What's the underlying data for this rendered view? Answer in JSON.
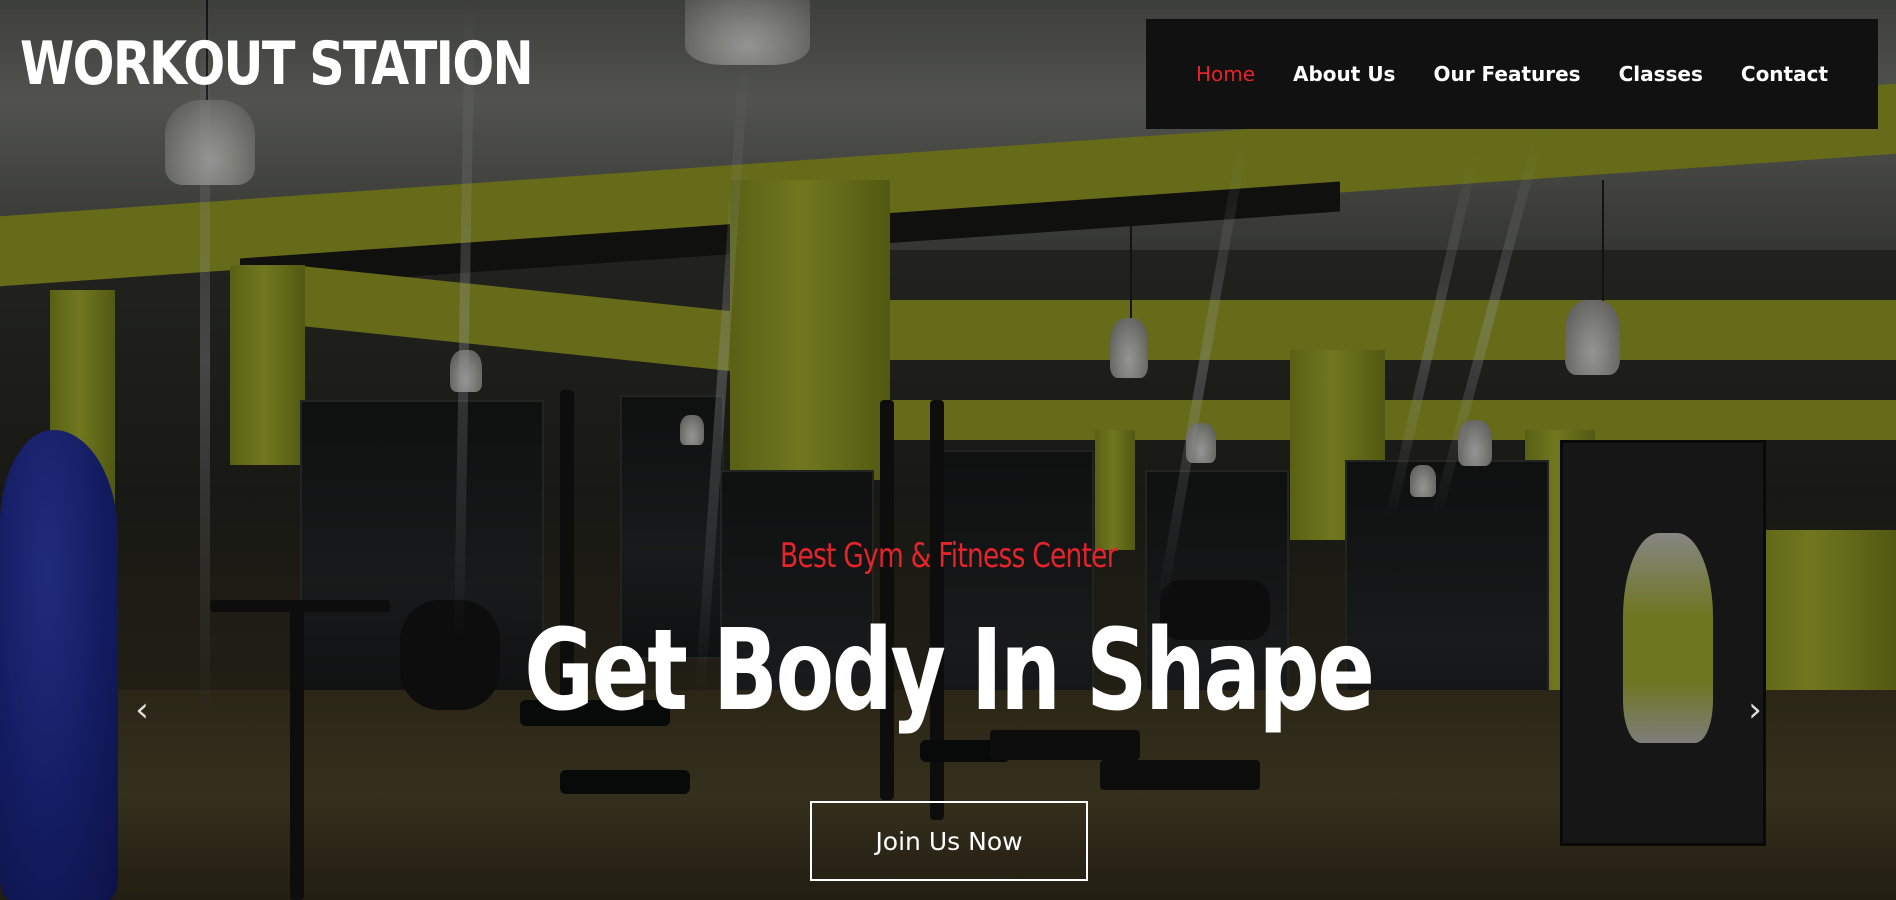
{
  "brand": {
    "name": "WORKOUT STATION"
  },
  "nav": {
    "items": [
      {
        "label": "Home",
        "active": true
      },
      {
        "label": "About Us",
        "active": false
      },
      {
        "label": "Our Features",
        "active": false
      },
      {
        "label": "Classes",
        "active": false
      },
      {
        "label": "Contact",
        "active": false
      }
    ]
  },
  "hero": {
    "subtitle": "Best Gym & Fitness Center",
    "headline": "Get Body In Shape",
    "cta_label": "Join Us Now"
  },
  "carousel": {
    "prev_icon": "chevron-left-icon",
    "next_icon": "chevron-right-icon",
    "prev_glyph": "‹",
    "next_glyph": "›"
  },
  "colors": {
    "accent": "#e3242b",
    "nav_background": "#111111",
    "text": "#ffffff",
    "wall_accent": "#bfcb38"
  }
}
